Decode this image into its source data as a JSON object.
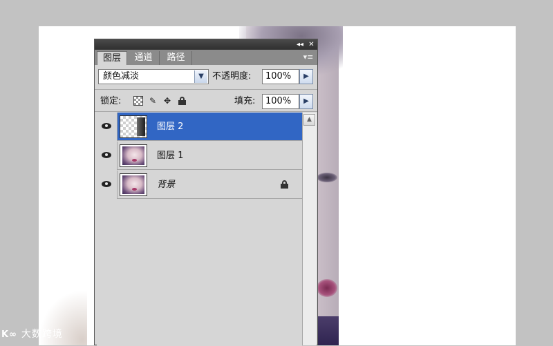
{
  "panel": {
    "titlebar": {
      "collapse_icon": "double-chevron-left-icon",
      "close_glyph": "✕"
    },
    "tabs": [
      {
        "label": "图层",
        "active": true
      },
      {
        "label": "通道",
        "active": false
      },
      {
        "label": "路径",
        "active": false
      }
    ],
    "menu_icon": "panel-menu-icon",
    "blend_mode": "颜色减淡",
    "opacity_label": "不透明度:",
    "opacity_value": "100%",
    "lock_label": "锁定:",
    "lock_icons": [
      "lock-transparent-icon",
      "lock-paint-icon",
      "lock-position-icon",
      "lock-all-icon"
    ],
    "fill_label": "填充:",
    "fill_value": "100%",
    "layers": [
      {
        "name": "图层 2",
        "visible": true,
        "selected": true,
        "thumb": "checker"
      },
      {
        "name": "图层 1",
        "visible": true,
        "selected": false,
        "thumb": "face"
      },
      {
        "name": "背景",
        "visible": true,
        "selected": false,
        "thumb": "face",
        "locked": true
      }
    ],
    "colors": {
      "selection": "#3166c4",
      "panel_bg": "#d6d6d6",
      "tabbar_bg": "#8b8b8b"
    }
  },
  "watermark": {
    "logo": "K∞",
    "text": "大数跨境"
  }
}
